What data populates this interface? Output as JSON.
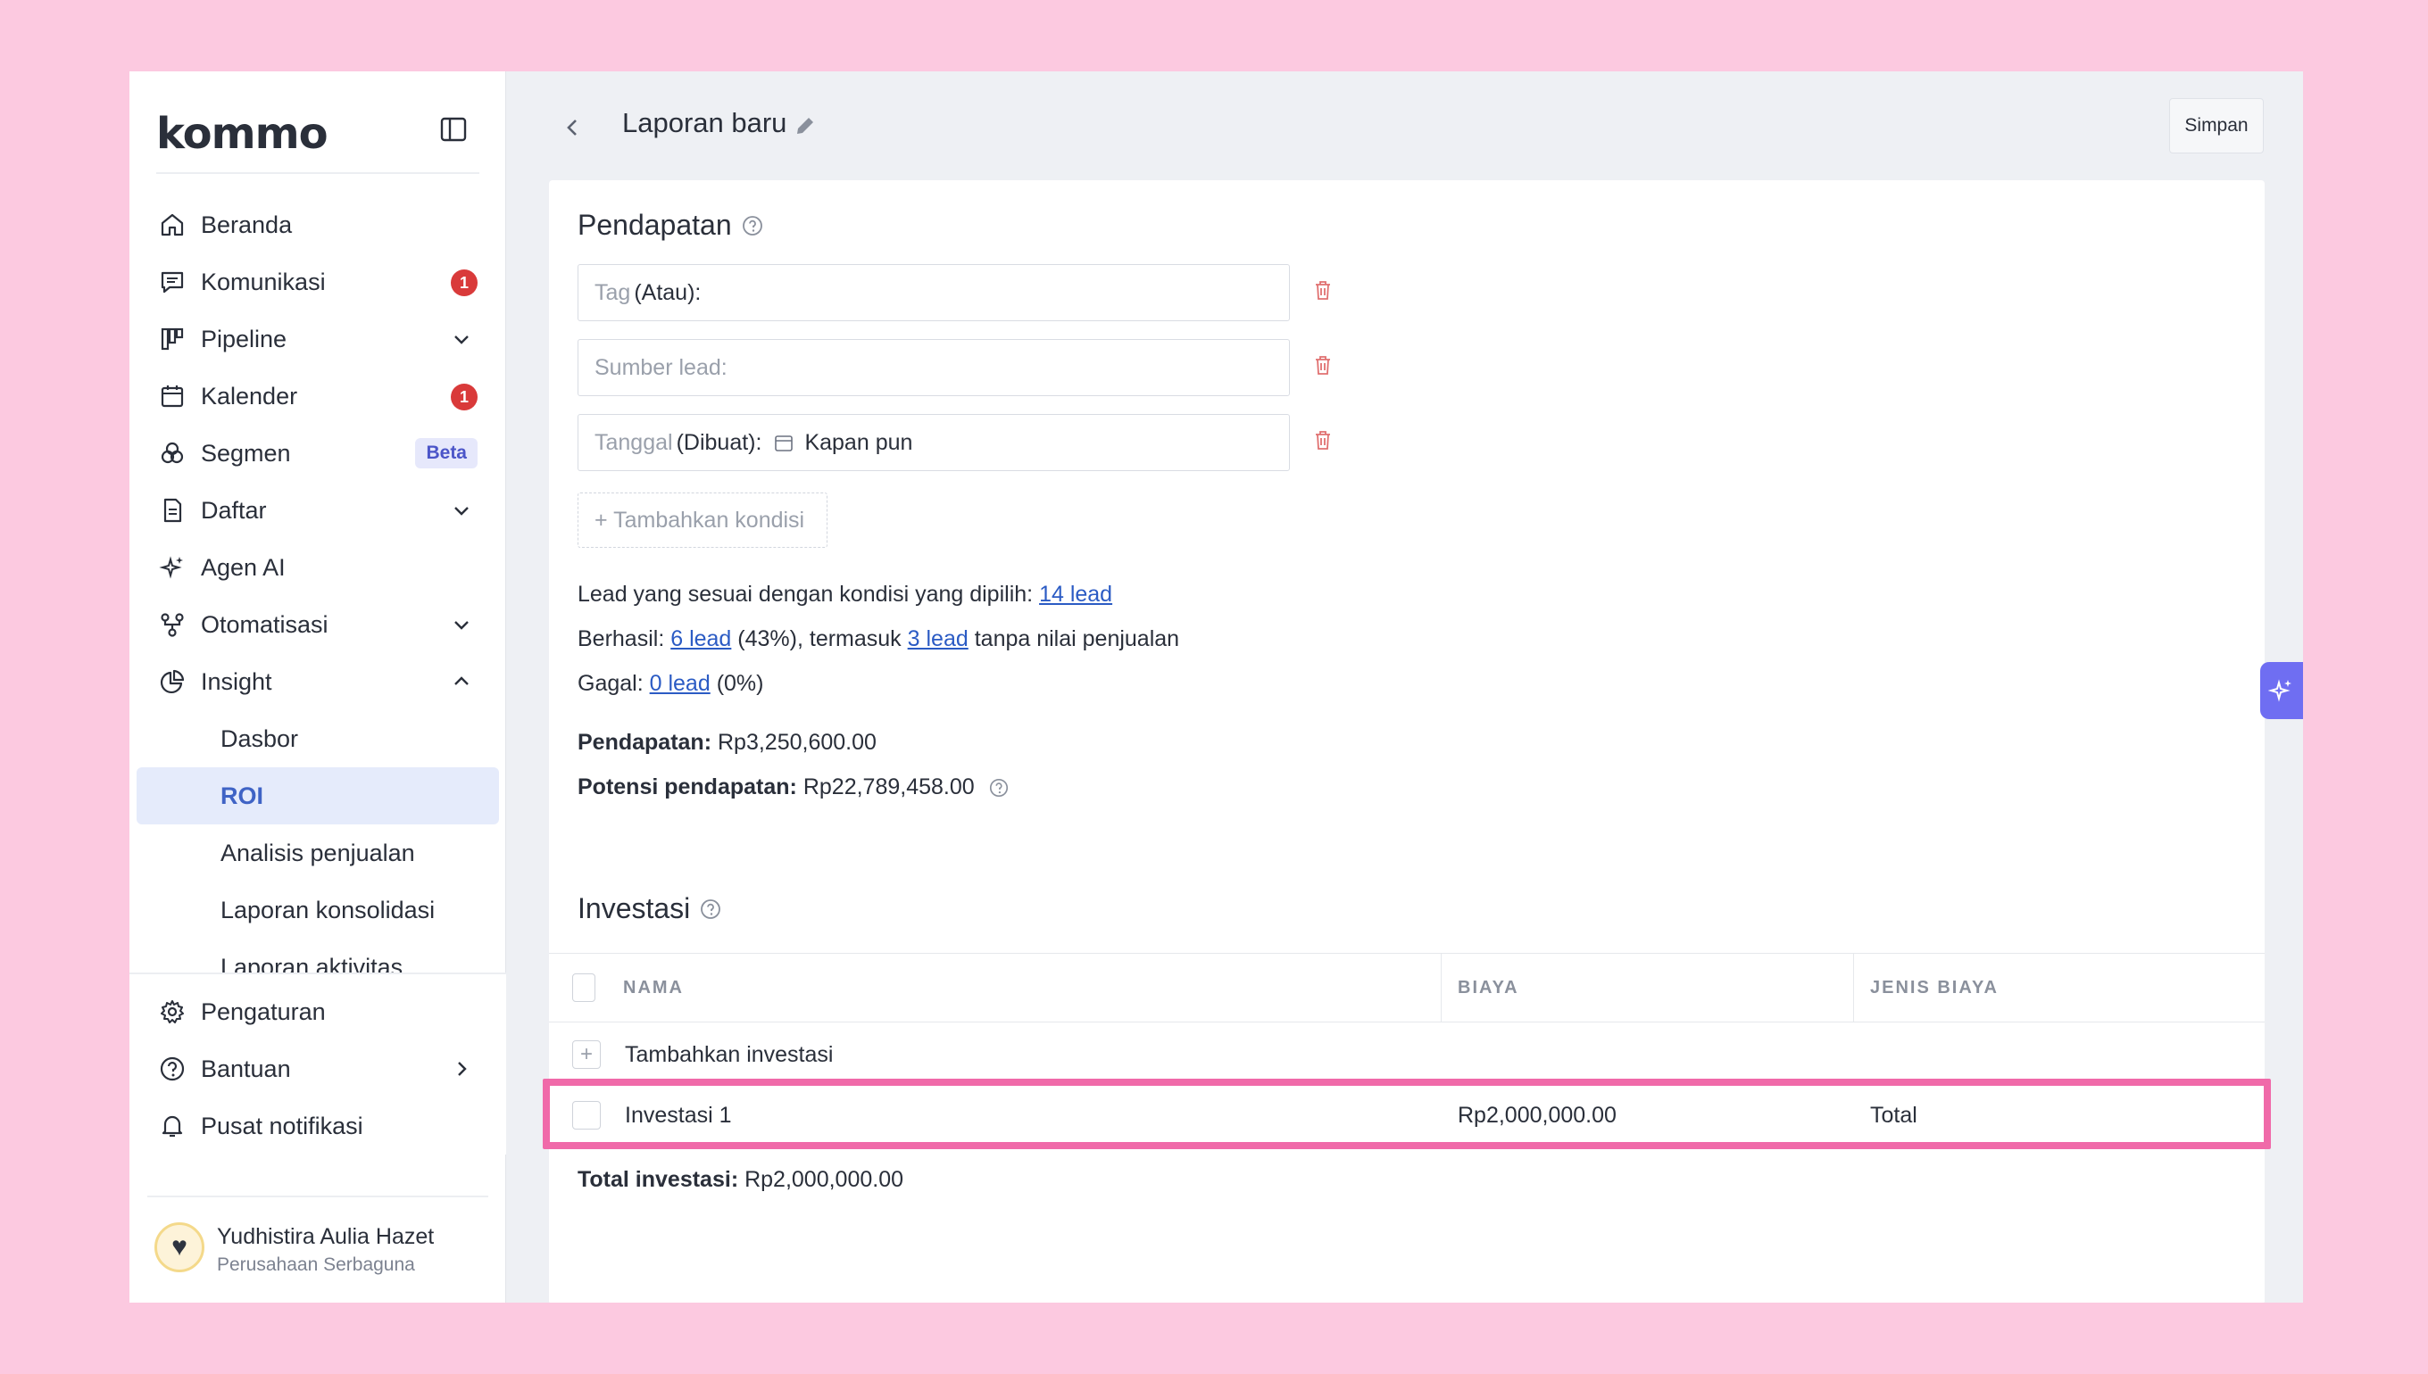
{
  "app": {
    "logo": "kommo"
  },
  "sidebar": {
    "items": [
      {
        "label": "Beranda",
        "icon": "home-icon"
      },
      {
        "label": "Komunikasi",
        "icon": "chat-icon",
        "badge": "1"
      },
      {
        "label": "Pipeline",
        "icon": "pipeline-icon"
      },
      {
        "label": "Kalender",
        "icon": "calendar-icon",
        "badge": "1"
      },
      {
        "label": "Segmen",
        "icon": "segment-icon",
        "tag": "Beta"
      },
      {
        "label": "Daftar",
        "icon": "list-icon"
      },
      {
        "label": "Agen AI",
        "icon": "sparkle-icon"
      },
      {
        "label": "Otomatisasi",
        "icon": "automation-icon"
      },
      {
        "label": "Insight",
        "icon": "pie-chart-icon"
      }
    ],
    "sub_items": [
      "Dasbor",
      "ROI",
      "Analisis penjualan",
      "Laporan konsolidasi",
      "Laporan aktivitas"
    ],
    "bottom_items": [
      {
        "label": "Pengaturan",
        "icon": "gear-icon"
      },
      {
        "label": "Bantuan",
        "icon": "help-icon"
      },
      {
        "label": "Pusat notifikasi",
        "icon": "bell-icon"
      }
    ],
    "user": {
      "name": "Yudhistira Aulia Hazet",
      "company": "Perusahaan Serbaguna"
    }
  },
  "header": {
    "title": "Laporan baru",
    "save_label": "Simpan"
  },
  "revenue": {
    "title": "Pendapatan",
    "filters": [
      {
        "label": "Tag",
        "qualifier": "(Atau):",
        "value": ""
      },
      {
        "label": "Sumber lead:",
        "qualifier": "",
        "value": ""
      },
      {
        "label": "Tanggal",
        "qualifier": "(Dibuat):",
        "value": "Kapan pun"
      }
    ],
    "add_condition": "+ Tambahkan kondisi",
    "matched_prefix": "Lead yang sesuai dengan kondisi yang dipilih:",
    "matched_link": "14 lead",
    "success_prefix": "Berhasil:",
    "success_link": "6 lead",
    "success_mid": "(43%), termasuk",
    "success_link2": "3 lead",
    "success_suffix": "tanpa nilai penjualan",
    "fail_prefix": "Gagal:",
    "fail_link": "0 lead",
    "fail_suffix": "(0%)",
    "revenue_label": "Pendapatan:",
    "revenue_value": "Rp3,250,600.00",
    "potential_label": "Potensi pendapatan:",
    "potential_value": "Rp22,789,458.00"
  },
  "investment": {
    "title": "Investasi",
    "columns": [
      "NAMA",
      "BIAYA",
      "JENIS BIAYA"
    ],
    "add_label": "Tambahkan investasi",
    "rows": [
      {
        "name": "Investasi 1",
        "cost": "Rp2,000,000.00",
        "type": "Total"
      }
    ],
    "total_label": "Total investasi:",
    "total_value": "Rp2,000,000.00"
  },
  "colors": {
    "accent": "#3f63c5",
    "highlight": "#f06aa9",
    "badge": "#d93a3a",
    "link": "#2b5bc4"
  }
}
